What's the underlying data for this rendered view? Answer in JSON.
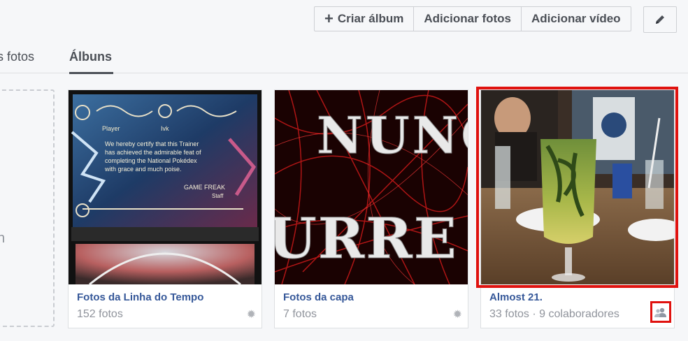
{
  "toolbar": {
    "create_album": "Criar álbum",
    "add_photos": "Adicionar fotos",
    "add_video": "Adicionar vídeo",
    "edit_icon": "pencil-icon"
  },
  "tabs": {
    "photos": "as fotos",
    "albums": "Álbuns"
  },
  "placeholder_char": "n",
  "albums": [
    {
      "title": "Fotos da Linha do Tempo",
      "count": "152 fotos",
      "icon": "gear-icon"
    },
    {
      "title": "Fotos da capa",
      "count": "7 fotos",
      "icon": "gear-icon"
    },
    {
      "title": "Almost 21.",
      "count": "33 fotos · 9 colaboradores",
      "icon": "people-icon"
    }
  ],
  "thumb1": {
    "player_label": "Player",
    "player_name": "Ivk",
    "certificate": [
      "We hereby certify that this Trainer",
      "has achieved the admirable feat of",
      "completing the National Pokédex",
      "with grace and much poise."
    ],
    "signature": "GAME FREAK",
    "signature_sub": "Staff"
  },
  "thumb2": {
    "line1": "NUNC",
    "line2": "URRE"
  },
  "colors": {
    "link": "#365899",
    "highlight": "#e0120f"
  }
}
